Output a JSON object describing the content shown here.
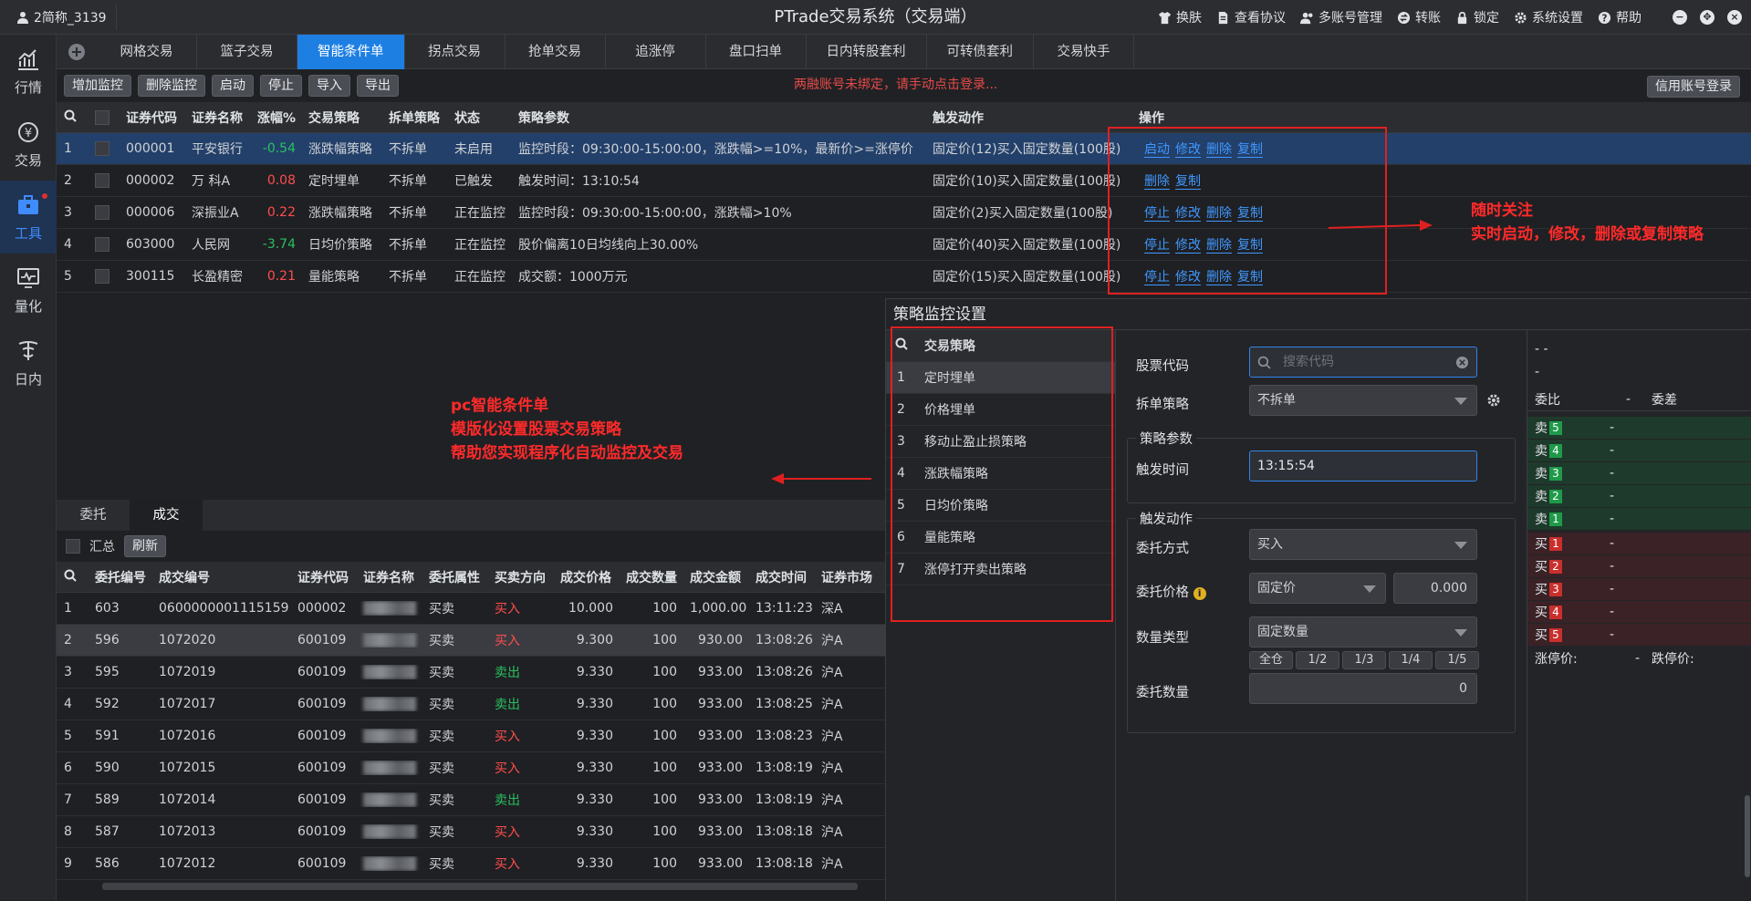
{
  "titlebar": {
    "user": "2简称_3139",
    "title": "PTrade交易系统（交易端）",
    "menu": [
      "换肤",
      "查看协议",
      "多账号管理",
      "转账",
      "锁定",
      "系统设置",
      "帮助"
    ]
  },
  "sidebar": {
    "items": [
      {
        "label": "行情",
        "icon": "chart-icon"
      },
      {
        "label": "交易",
        "icon": "yen-icon"
      },
      {
        "label": "工具",
        "icon": "toolbox-icon"
      },
      {
        "label": "量化",
        "icon": "monitor-icon"
      },
      {
        "label": "日内",
        "icon": "intraday-icon"
      }
    ]
  },
  "tabs": [
    "网格交易",
    "篮子交易",
    "智能条件单",
    "拐点交易",
    "抢单交易",
    "追涨停",
    "盘口扫单",
    "日内转股套利",
    "可转债套利",
    "交易快手"
  ],
  "toolbar": {
    "buttons": [
      "增加监控",
      "删除监控",
      "启动",
      "停止",
      "导入",
      "导出"
    ],
    "warning": "两融账号未绑定，请手动点击登录...",
    "login": "信用账号登录"
  },
  "monitor_table": {
    "headers": [
      "证券代码",
      "证券名称",
      "涨幅%",
      "交易策略",
      "拆单策略",
      "状态",
      "策略参数",
      "触发动作",
      "操作"
    ],
    "rows": [
      {
        "idx": "1",
        "code": "000001",
        "name": "平安银行",
        "pct": "-0.54",
        "strategy": "涨跌幅策略",
        "split": "不拆单",
        "status": "未启用",
        "param": "监控时段：09:30:00-15:00:00，涨跌幅>=10%，最新价>=涨停价",
        "action": "固定价(12)买入固定数量(100股)",
        "ops": [
          "启动",
          "修改",
          "删除",
          "复制"
        ]
      },
      {
        "idx": "2",
        "code": "000002",
        "name": "万 科A",
        "pct": "0.08",
        "strategy": "定时埋单",
        "split": "不拆单",
        "status": "已触发",
        "param": "触发时间：13:10:54",
        "action": "固定价(10)买入固定数量(100股)",
        "ops": [
          "删除",
          "复制"
        ]
      },
      {
        "idx": "3",
        "code": "000006",
        "name": "深振业A",
        "pct": "0.22",
        "strategy": "涨跌幅策略",
        "split": "不拆单",
        "status": "正在监控",
        "param": "监控时段：09:30:00-15:00:00，涨跌幅>10%",
        "action": "固定价(2)买入固定数量(100股)",
        "ops": [
          "停止",
          "修改",
          "删除",
          "复制"
        ]
      },
      {
        "idx": "4",
        "code": "603000",
        "name": "人民网",
        "pct": "-3.74",
        "strategy": "日均价策略",
        "split": "不拆单",
        "status": "正在监控",
        "param": "股价偏离10日均线向上30.00%",
        "action": "固定价(40)买入固定数量(100股)",
        "ops": [
          "停止",
          "修改",
          "删除",
          "复制"
        ]
      },
      {
        "idx": "5",
        "code": "300115",
        "name": "长盈精密",
        "pct": "0.21",
        "strategy": "量能策略",
        "split": "不拆单",
        "status": "正在监控",
        "param": "成交额：1000万元",
        "action": "固定价(15)买入固定数量(100股)",
        "ops": [
          "停止",
          "修改",
          "删除",
          "复制"
        ]
      }
    ]
  },
  "annotations": {
    "right_line1": "随时关注",
    "right_line2": "实时启动，修改，删除或复制策略",
    "left_line1": "pc智能条件单",
    "left_line2": "模版化设置股票交易策略",
    "left_line3": "帮助您实现程序化自动监控及交易"
  },
  "lower": {
    "tabs": [
      "委托",
      "成交"
    ],
    "summary_label": "汇总",
    "refresh": "刷新",
    "headers": [
      "委托编号",
      "成交编号",
      "证券代码",
      "证券名称",
      "委托属性",
      "买卖方向",
      "成交价格",
      "成交数量",
      "成交金额",
      "成交时间",
      "证券市场"
    ],
    "rows": [
      {
        "idx": "1",
        "order": "603",
        "deal": "0600000001115159",
        "code": "000002",
        "attr": "买卖",
        "dir": "买入",
        "price": "10.000",
        "qty": "100",
        "amt": "1,000.00",
        "time": "13:11:23",
        "mkt": "深A"
      },
      {
        "idx": "2",
        "order": "596",
        "deal": "1072020",
        "code": "600109",
        "attr": "买卖",
        "dir": "买入",
        "price": "9.300",
        "qty": "100",
        "amt": "930.00",
        "time": "13:08:26",
        "mkt": "沪A"
      },
      {
        "idx": "3",
        "order": "595",
        "deal": "1072019",
        "code": "600109",
        "attr": "买卖",
        "dir": "卖出",
        "price": "9.330",
        "qty": "100",
        "amt": "933.00",
        "time": "13:08:26",
        "mkt": "沪A"
      },
      {
        "idx": "4",
        "order": "592",
        "deal": "1072017",
        "code": "600109",
        "attr": "买卖",
        "dir": "卖出",
        "price": "9.330",
        "qty": "100",
        "amt": "933.00",
        "time": "13:08:25",
        "mkt": "沪A"
      },
      {
        "idx": "5",
        "order": "591",
        "deal": "1072016",
        "code": "600109",
        "attr": "买卖",
        "dir": "买入",
        "price": "9.330",
        "qty": "100",
        "amt": "933.00",
        "time": "13:08:23",
        "mkt": "沪A"
      },
      {
        "idx": "6",
        "order": "590",
        "deal": "1072015",
        "code": "600109",
        "attr": "买卖",
        "dir": "买入",
        "price": "9.330",
        "qty": "100",
        "amt": "933.00",
        "time": "13:08:19",
        "mkt": "沪A"
      },
      {
        "idx": "7",
        "order": "589",
        "deal": "1072014",
        "code": "600109",
        "attr": "买卖",
        "dir": "卖出",
        "price": "9.330",
        "qty": "100",
        "amt": "933.00",
        "time": "13:08:19",
        "mkt": "沪A"
      },
      {
        "idx": "8",
        "order": "587",
        "deal": "1072013",
        "code": "600109",
        "attr": "买卖",
        "dir": "买入",
        "price": "9.330",
        "qty": "100",
        "amt": "933.00",
        "time": "13:08:18",
        "mkt": "沪A"
      },
      {
        "idx": "9",
        "order": "586",
        "deal": "1072012",
        "code": "600109",
        "attr": "买卖",
        "dir": "买入",
        "price": "9.330",
        "qty": "100",
        "amt": "933.00",
        "time": "13:08:18",
        "mkt": "沪A"
      }
    ]
  },
  "panel": {
    "title": "策略监控设置",
    "list_header": "交易策略",
    "strategies": [
      "定时埋单",
      "价格埋单",
      "移动止盈止损策略",
      "涨跌幅策略",
      "日均价策略",
      "量能策略",
      "涨停打开卖出策略"
    ],
    "stock_code_label": "股票代码",
    "search_placeholder": "搜索代码",
    "split_label": "拆单策略",
    "split_value": "不拆单",
    "param_group": "策略参数",
    "trigger_time_label": "触发时间",
    "trigger_time_value": "13:15:54",
    "action_group": "触发动作",
    "order_mode_label": "委托方式",
    "order_mode_value": "买入",
    "order_price_label": "委托价格",
    "order_price_type": "固定价",
    "order_price_value": "0.000",
    "qty_type_label": "数量类型",
    "qty_type_value": "固定数量",
    "fractions": [
      "全仓",
      "1/2",
      "1/3",
      "1/4",
      "1/5"
    ],
    "qty_label": "委托数量",
    "qty_value": "0"
  },
  "orderbook": {
    "top1": "- -",
    "top2": "-",
    "wb_label": "委比",
    "wb_value": "-",
    "wc_label": "委差",
    "sell": [
      {
        "label": "卖",
        "n": "5",
        "v": "-"
      },
      {
        "label": "卖",
        "n": "4",
        "v": "-"
      },
      {
        "label": "卖",
        "n": "3",
        "v": "-"
      },
      {
        "label": "卖",
        "n": "2",
        "v": "-"
      },
      {
        "label": "卖",
        "n": "1",
        "v": "-"
      }
    ],
    "buy": [
      {
        "label": "买",
        "n": "1",
        "v": "-"
      },
      {
        "label": "买",
        "n": "2",
        "v": "-"
      },
      {
        "label": "买",
        "n": "3",
        "v": "-"
      },
      {
        "label": "买",
        "n": "4",
        "v": "-"
      },
      {
        "label": "买",
        "n": "5",
        "v": "-"
      }
    ],
    "limit_up_label": "涨停价:",
    "limit_up_value": "-",
    "limit_down_label": "跌停价:"
  }
}
